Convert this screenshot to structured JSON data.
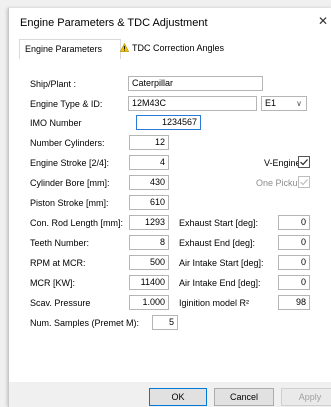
{
  "window": {
    "title": "Engine Parameters & TDC Adjustment",
    "close_glyph": "✕"
  },
  "tabs": [
    {
      "label": "Engine Parameters",
      "active": true
    },
    {
      "label": "TDC Correction Angles",
      "icon": "warning-icon",
      "active": false
    }
  ],
  "form": {
    "ship_plant": {
      "label": "Ship/Plant :",
      "value": "Caterpillar"
    },
    "engine_type": {
      "label": "Engine Type & ID:",
      "value": "12M43C",
      "id_value": "E1"
    },
    "imo": {
      "label": "IMO Number",
      "value": "1234567"
    },
    "cylinders": {
      "label": "Number Cylinders:",
      "value": "12"
    },
    "stroke_type": {
      "label": "Engine Stroke [2/4]:",
      "value": "4"
    },
    "bore": {
      "label": "Cylinder Bore [mm]:",
      "value": "430"
    },
    "piston_stroke": {
      "label": "Piston Stroke [mm]:",
      "value": "610"
    },
    "con_rod": {
      "label": "Con. Rod Length [mm]:",
      "value": "1293"
    },
    "teeth": {
      "label": "Teeth  Number:",
      "value": "8"
    },
    "rpm": {
      "label": "RPM at MCR:",
      "value": "500"
    },
    "mcr": {
      "label": "MCR [KW]:",
      "value": "11400"
    },
    "scav": {
      "label": "Scav. Pressure",
      "value": "1.000"
    },
    "samples": {
      "label": "Num. Samples (Premet M):",
      "value": "5"
    },
    "v_engine": {
      "label": "V-Engine:",
      "checked": true
    },
    "one_pickup": {
      "label": "One Pickup",
      "checked": true,
      "disabled": true
    },
    "exhaust_start": {
      "label": "Exhaust Start [deg]:",
      "value": "0"
    },
    "exhaust_end": {
      "label": "Exhaust End [deg]:",
      "value": "0"
    },
    "air_start": {
      "label": "Air Intake Start [deg]:",
      "value": "0"
    },
    "air_end": {
      "label": "Air Intake End [deg]:",
      "value": "0"
    },
    "ignition": {
      "label": "Iginition model R²",
      "value": "98"
    }
  },
  "buttons": {
    "ok": "OK",
    "cancel": "Cancel",
    "apply": "Apply"
  },
  "colors": {
    "accent": "#0078d7",
    "field_focus": "#2b79d6",
    "warning": "#f2c200"
  }
}
